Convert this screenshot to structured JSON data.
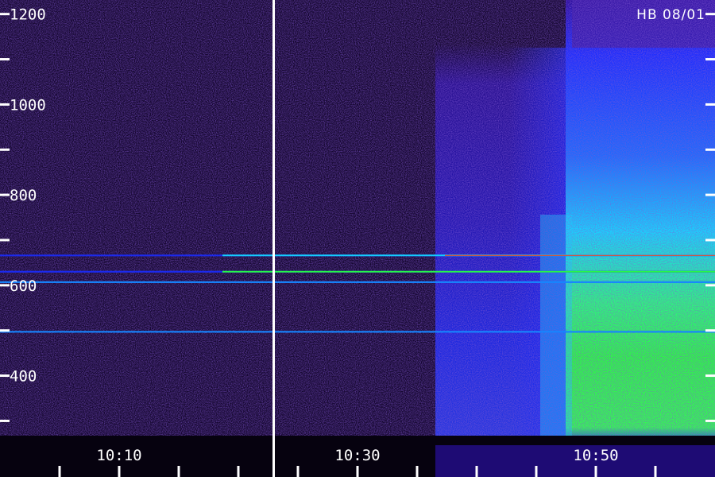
{
  "chart_data": {
    "type": "heatmap",
    "annotation": "HB 08/01",
    "y_ticks": [
      400,
      600,
      800,
      1000,
      1200
    ],
    "x_ticks": [
      "10:10",
      "10:30",
      "10:50"
    ],
    "ylim": [
      255,
      1210
    ],
    "x_minutes": [
      10.0,
      10.3,
      10.5
    ],
    "colors": {
      "background": "#14062e",
      "noise": "#3a1aa8",
      "blue": "#1a2cff",
      "cyan": "#14d8ff",
      "green": "#28ff40",
      "line_red": "#ff3a10",
      "axis": "#ffffff"
    },
    "emission_lines": [
      {
        "y": 666,
        "strength": "strong"
      },
      {
        "y": 630,
        "strength": "medium"
      },
      {
        "y": 607,
        "strength": "weak"
      },
      {
        "y": 497,
        "strength": "weak"
      }
    ]
  }
}
